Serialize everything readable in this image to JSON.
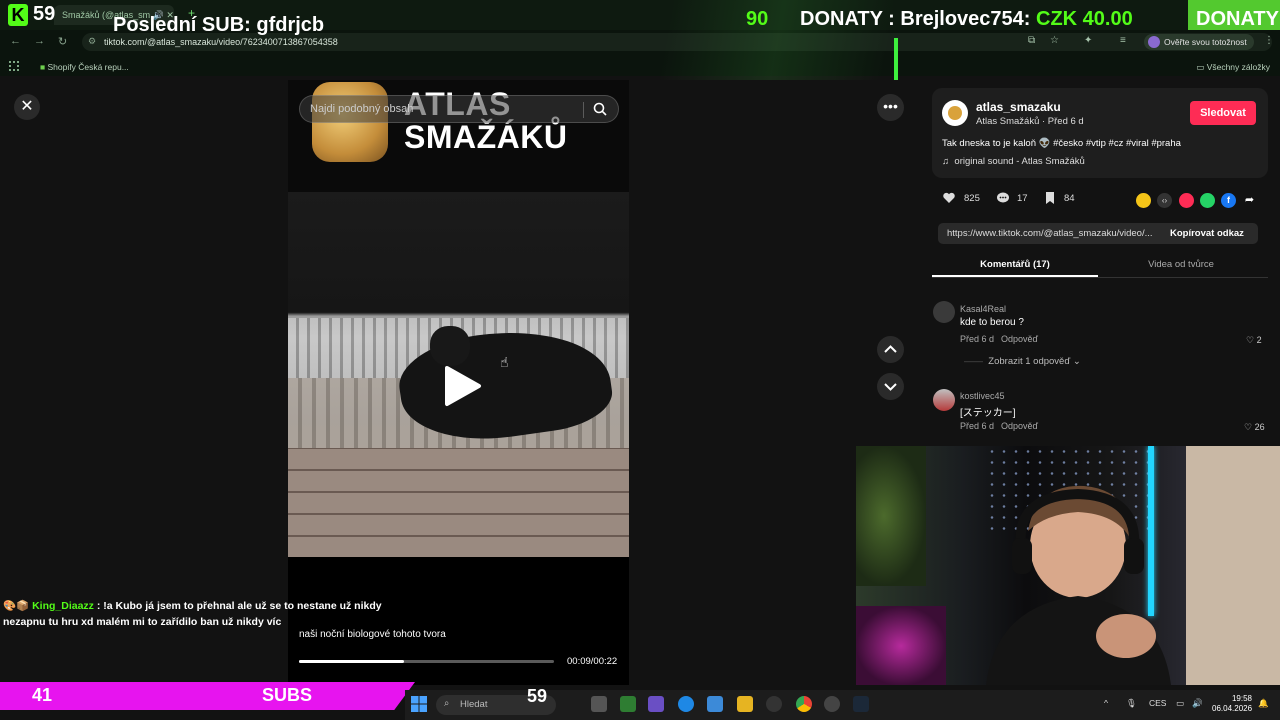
{
  "browser": {
    "tab_title": "Smažáků (@atlas_sm",
    "url": "tiktok.com/@atlas_smazaku/video/7623400713867054358",
    "verify_label": "Ověřte svou totožnost",
    "bookmark_left": "Shopify Česká repu...",
    "bookmark_right": "Všechny záložky"
  },
  "overlay": {
    "viewers": "59",
    "last_sub": "Poslední SUB: gfdrjcb",
    "counter": "90",
    "donaty_label": "DONATY : Brejlovec754:",
    "donaty_amount": "CZK 40.00",
    "donaty_repeat": "DONATY"
  },
  "video": {
    "search_placeholder": "Najdi podobný obsah",
    "brand_line1": "ATLAS",
    "brand_line2": "SMAŽÁKŮ",
    "caption": "naši noční biologové tohoto tvora",
    "timecode": "00:09/00:22",
    "progress": 0.41
  },
  "post": {
    "author_handle": "atlas_smazaku",
    "author_sub": "Atlas Smažáků · Před 6 d",
    "follow_label": "Sledovat",
    "description": "Tak dneska to je kaloň 👽 #česko #vtip #cz #viral #praha",
    "sound": "original sound - Atlas Smažáků",
    "likes": "825",
    "comments": "17",
    "saves": "84",
    "link": "https://www.tiktok.com/@atlas_smazaku/video/...",
    "copy_label": "Kopírovat odkaz",
    "tab_comments": "Komentářů (17)",
    "tab_creator": "Videa od tvůrce"
  },
  "comments": [
    {
      "user": "Kasal4Real",
      "text": "kde to berou ?",
      "meta": "Před 6 d",
      "reply": "Odpověď",
      "likes": "2",
      "more": "Zobrazit 1 odpověď"
    },
    {
      "user": "kostlivec45",
      "text": "[ステッカー]",
      "meta": "Před 6 d",
      "reply": "Odpověď",
      "likes": "26"
    }
  ],
  "chat": {
    "nick": "King_Diaazz",
    "line1": ": !a Kubo já jsem to přehnal ale už se to nestane už nikdy",
    "line2": "nezapnu tu hru xd malém mi to zařídilo ban už nikdy víc"
  },
  "bottom": {
    "subs_count": "41",
    "subs_label": "SUBS",
    "taskbar_num": "59",
    "search_label": "Hledat",
    "lang": "CES",
    "time": "19:58",
    "date": "06.04.2026"
  },
  "colors": {
    "kick_green": "#53fc18",
    "follow_red": "#fe2c55",
    "subs_magenta": "#e714ef"
  }
}
